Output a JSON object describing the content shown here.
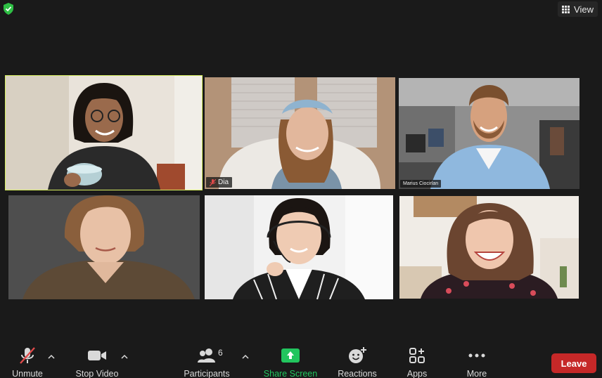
{
  "top": {
    "view_label": "View",
    "security_icon": "shield-check-icon"
  },
  "participants": [
    {
      "name": "",
      "active_speaker": true
    },
    {
      "name": "Dia",
      "muted": true
    },
    {
      "name": "Marius Ciocirlan"
    },
    {
      "name": ""
    },
    {
      "name": ""
    },
    {
      "name": ""
    }
  ],
  "toolbar": {
    "unmute_label": "Unmute",
    "stop_video_label": "Stop Video",
    "participants_label": "Participants",
    "participants_count": "6",
    "share_screen_label": "Share Screen",
    "reactions_label": "Reactions",
    "apps_label": "Apps",
    "more_label": "More",
    "leave_label": "Leave"
  },
  "colors": {
    "active_border": "#d6ee5e",
    "share_green": "#22c55e",
    "leave_red": "#c62828"
  }
}
